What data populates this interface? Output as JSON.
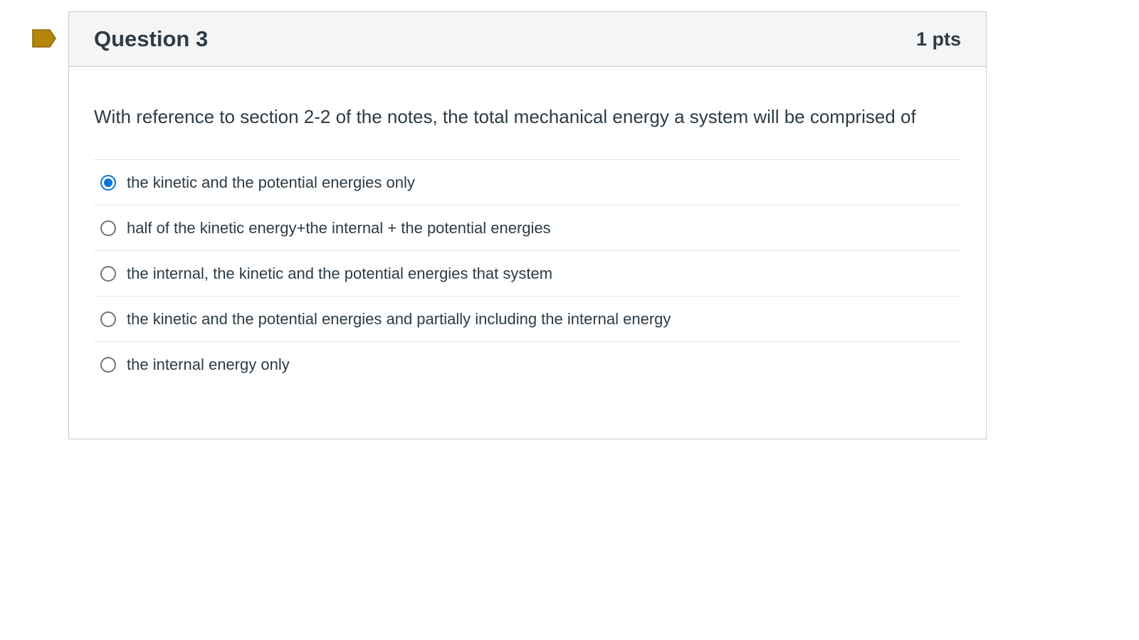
{
  "flag": {
    "icon": "flag-icon",
    "color": "#b5860b"
  },
  "question": {
    "title": "Question 3",
    "points": "1 pts",
    "text": "With reference to section 2-2 of the notes, the total mechanical energy a system will be comprised of",
    "answers": [
      {
        "label": "the kinetic and the potential energies only",
        "selected": true
      },
      {
        "label": "half of the kinetic energy+the internal + the potential energies",
        "selected": false
      },
      {
        "label": "the internal, the kinetic and the potential energies that system",
        "selected": false
      },
      {
        "label": "the kinetic and the potential energies and partially including the internal energy",
        "selected": false
      },
      {
        "label": "the internal energy only",
        "selected": false
      }
    ]
  },
  "colors": {
    "accent": "#0b74de",
    "header_bg": "#f5f5f5",
    "text": "#2d3b45"
  }
}
